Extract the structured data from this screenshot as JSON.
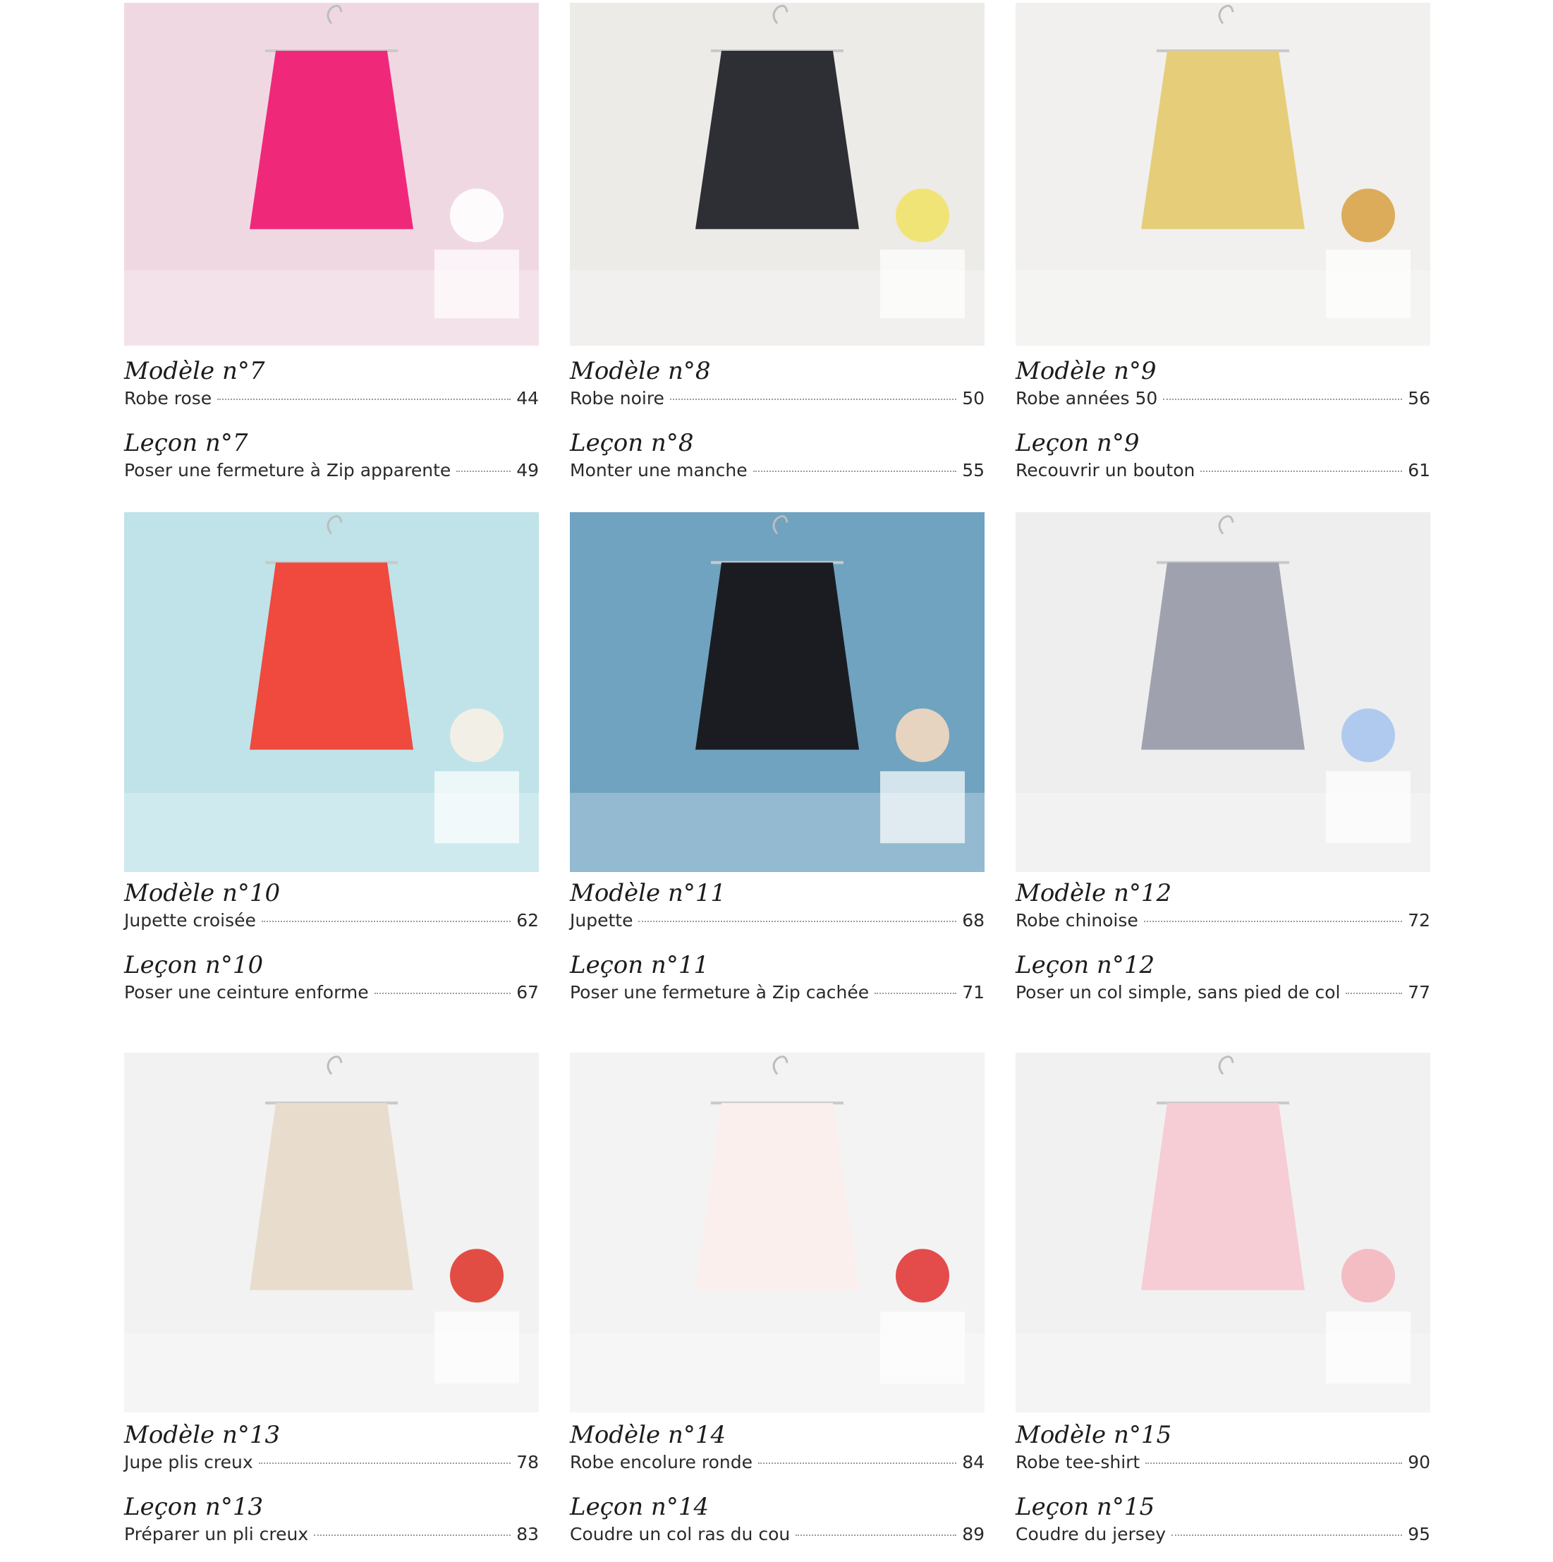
{
  "cards": [
    {
      "modele_heading": "Modèle n°7",
      "modele_title": "Robe rose",
      "modele_page": "44",
      "lecon_heading": "Leçon n°7",
      "lecon_title": "Poser une fermeture à Zip apparente",
      "lecon_page": "49",
      "photo": {
        "wall": "#f0d8e3",
        "garment": "#f0287a",
        "accent": "#ffffff"
      }
    },
    {
      "modele_heading": "Modèle n°8",
      "modele_title": "Robe noire",
      "modele_page": "50",
      "lecon_heading": "Leçon n°8",
      "lecon_title": "Monter une manche",
      "lecon_page": "55",
      "photo": {
        "wall": "#ecebe8",
        "garment": "#2e2f34",
        "accent": "#f2e36a"
      }
    },
    {
      "modele_heading": "Modèle n°9",
      "modele_title": "Robe années 50",
      "modele_page": "56",
      "lecon_heading": "Leçon n°9",
      "lecon_title": "Recouvrir un bouton",
      "lecon_page": "61",
      "photo": {
        "wall": "#f1f0ee",
        "garment": "#e6cd7a",
        "accent": "#d9a44a"
      }
    },
    {
      "modele_heading": "Modèle n°10",
      "modele_title": "Jupette croisée",
      "modele_page": "62",
      "lecon_heading": "Leçon n°10",
      "lecon_title": "Poser une ceinture enforme",
      "lecon_page": "67",
      "photo": {
        "wall": "#bfe3e8",
        "garment": "#f0493e",
        "accent": "#f7efe6"
      }
    },
    {
      "modele_heading": "Modèle n°11",
      "modele_title": "Jupette",
      "modele_page": "68",
      "lecon_heading": "Leçon n°11",
      "lecon_title": "Poser une fermeture à Zip cachée",
      "lecon_page": "71",
      "photo": {
        "wall": "#6fa3c0",
        "garment": "#1b1c22",
        "accent": "#f3d8c0"
      }
    },
    {
      "modele_heading": "Modèle n°12",
      "modele_title": "Robe chinoise",
      "modele_page": "72",
      "lecon_heading": "Leçon n°12",
      "lecon_title": "Poser un col simple, sans pied de col",
      "lecon_page": "77",
      "photo": {
        "wall": "#eeeeee",
        "garment": "#9fa2ae",
        "accent": "#a9c5ee"
      }
    },
    {
      "modele_heading": "Modèle n°13",
      "modele_title": "Jupe plis creux",
      "modele_page": "78",
      "lecon_heading": "Leçon n°13",
      "lecon_title": "Préparer un pli creux",
      "lecon_page": "83",
      "photo": {
        "wall": "#f2f2f2",
        "garment": "#e8ddcd",
        "accent": "#e03b30"
      }
    },
    {
      "modele_heading": "Modèle n°14",
      "modele_title": "Robe encolure ronde",
      "modele_page": "84",
      "lecon_heading": "Leçon n°14",
      "lecon_title": "Coudre un col ras du cou",
      "lecon_page": "89",
      "photo": {
        "wall": "#f3f3f3",
        "garment": "#fbefed",
        "accent": "#e23a3a"
      }
    },
    {
      "modele_heading": "Modèle n°15",
      "modele_title": "Robe tee-shirt",
      "modele_page": "90",
      "lecon_heading": "Leçon n°15",
      "lecon_title": "Coudre du jersey",
      "lecon_page": "95",
      "photo": {
        "wall": "#f2f1f1",
        "garment": "#f6cdd5",
        "accent": "#f4b7bf"
      }
    }
  ]
}
